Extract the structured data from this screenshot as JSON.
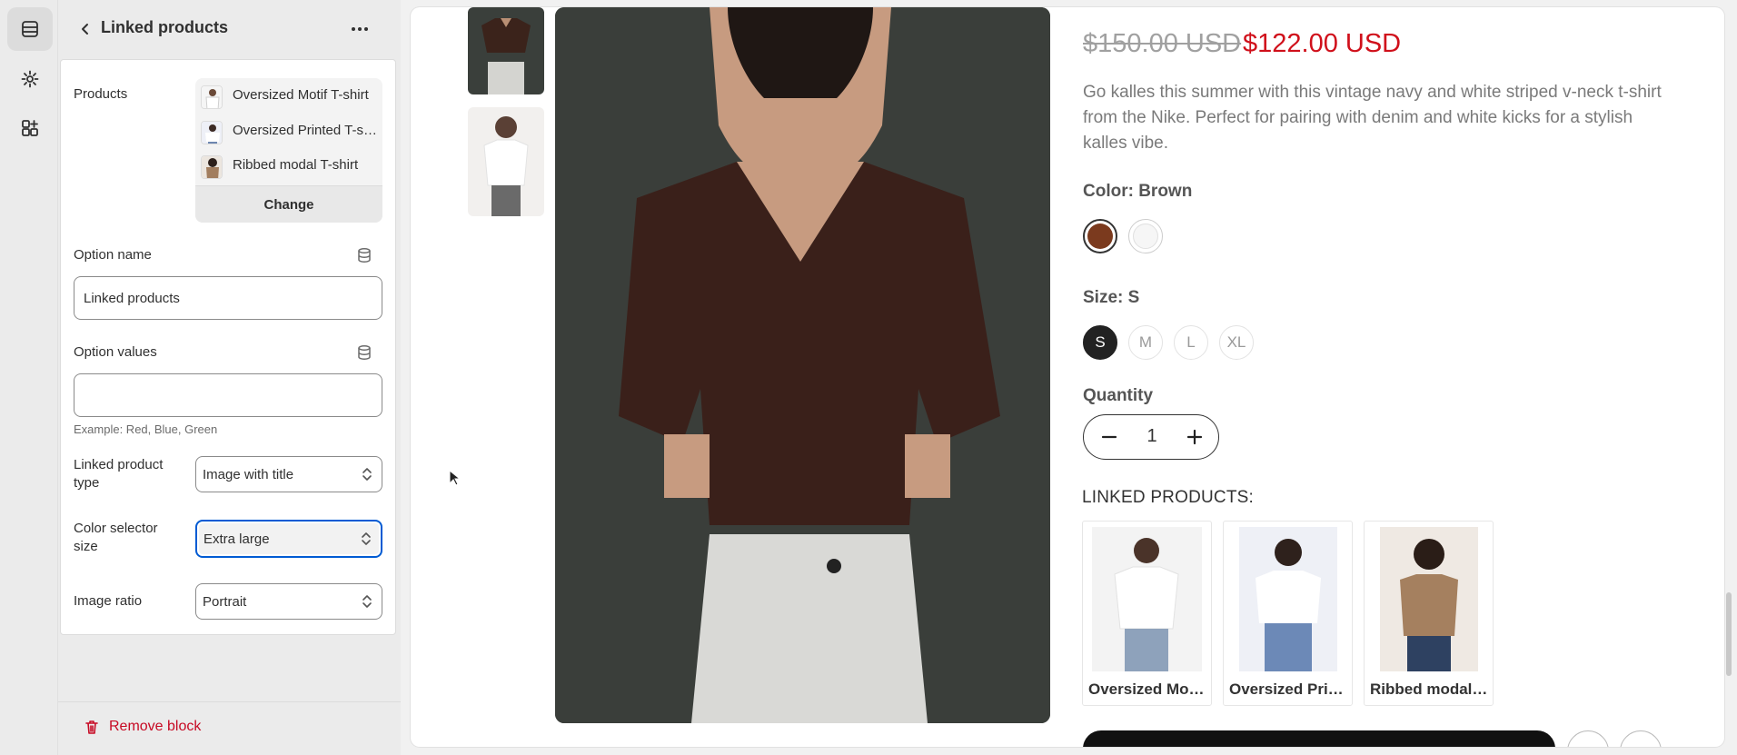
{
  "header": {
    "title": "Linked products"
  },
  "rail": {
    "icons": [
      "sections-icon",
      "settings-gear-icon",
      "apps-icon"
    ]
  },
  "products_field": {
    "label": "Products",
    "items": [
      {
        "name": "Oversized Motif T-shirt"
      },
      {
        "name": "Oversized Printed T-shirt"
      },
      {
        "name": "Ribbed modal T-shirt"
      }
    ],
    "change_label": "Change"
  },
  "option_name": {
    "label": "Option name",
    "value": "Linked products"
  },
  "option_values": {
    "label": "Option values",
    "value": "",
    "hint": "Example: Red, Blue, Green"
  },
  "linked_product_type": {
    "label": "Linked product type",
    "value": "Image with title"
  },
  "color_selector_size": {
    "label": "Color selector size",
    "value": "Extra large"
  },
  "image_ratio": {
    "label": "Image ratio",
    "value": "Portrait"
  },
  "remove_block": {
    "label": "Remove block"
  },
  "preview": {
    "price_old": "$150.00 USD",
    "price_new": "$122.00 USD",
    "description": "Go kalles this summer with this vintage navy and white striped v-neck t-shirt from the Nike. Perfect for pairing with denim and white kicks for a stylish kalles vibe.",
    "color_title": "Color: Brown",
    "size_title": "Size: S",
    "sizes": [
      "S",
      "M",
      "L",
      "XL"
    ],
    "selected_size": "S",
    "quantity_title": "Quantity",
    "quantity": "1",
    "linked_title": "LINKED PRODUCTS:",
    "linked_cards": [
      {
        "name": "Oversized Motif T-shirt"
      },
      {
        "name": "Oversized Printed T-shirt"
      },
      {
        "name": "Ribbed modal T-shirt"
      }
    ]
  },
  "colors": {
    "accent": "#005bd3",
    "danger": "#c70a24",
    "sale": "#d0101b",
    "swatch_brown": "#7b3a1e"
  }
}
